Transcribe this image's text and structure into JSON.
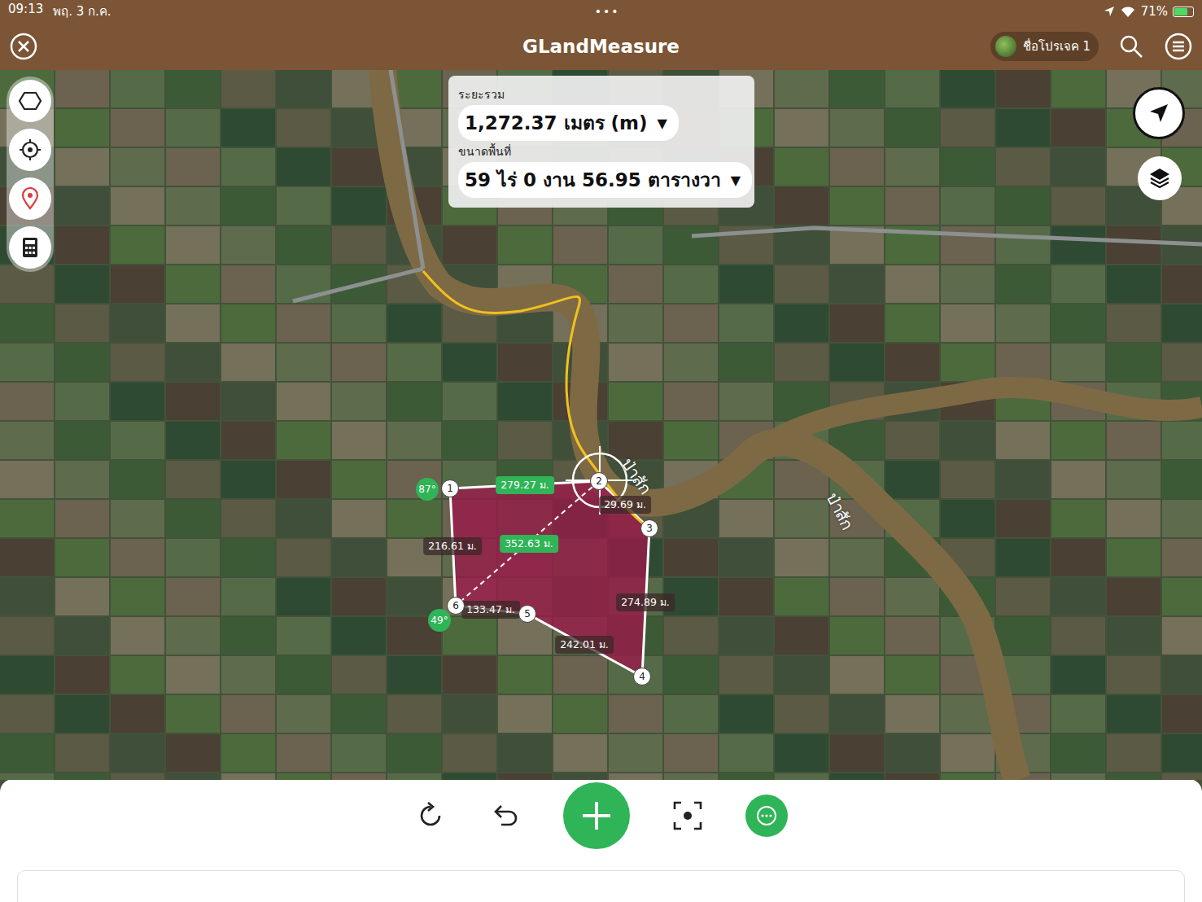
{
  "status_bar": {
    "time": "09:13",
    "date": "พฤ. 3 ก.ค.",
    "dots": "•••",
    "battery": "71%",
    "battery_level": 0.71,
    "charging": true
  },
  "header": {
    "title": "GLandMeasure",
    "project": "ชื่อโปรเจค 1"
  },
  "summary": {
    "distance_label": "ระยะรวม",
    "distance": "1,272.37 เมตร (m)",
    "area_label": "ขนาดพื้นที่",
    "area": "59 ไร่ 0 งาน 56.95 ตารางวา",
    "dropdown": "▼"
  },
  "vertices": [
    {
      "label": "1"
    },
    {
      "label": "2"
    },
    {
      "label": "3"
    },
    {
      "label": "4"
    },
    {
      "label": "5"
    },
    {
      "label": "6"
    }
  ],
  "edges": [
    {
      "label": "279.27 ม.",
      "highlighted": true
    },
    {
      "label": "29.69 ม.",
      "highlighted": false
    },
    {
      "label": "274.89 ม.",
      "highlighted": false
    },
    {
      "label": "242.01 ม.",
      "highlighted": false
    },
    {
      "label": "133.47 ม.",
      "highlighted": false
    },
    {
      "label": "216.61 ม.",
      "highlighted": false
    },
    {
      "label": "352.63 ม.",
      "highlighted": true
    }
  ],
  "angles": [
    {
      "label": "87°"
    },
    {
      "label": "49°"
    }
  ],
  "river_labels": [
    "ป่าสัก",
    "ป่าสัก"
  ]
}
